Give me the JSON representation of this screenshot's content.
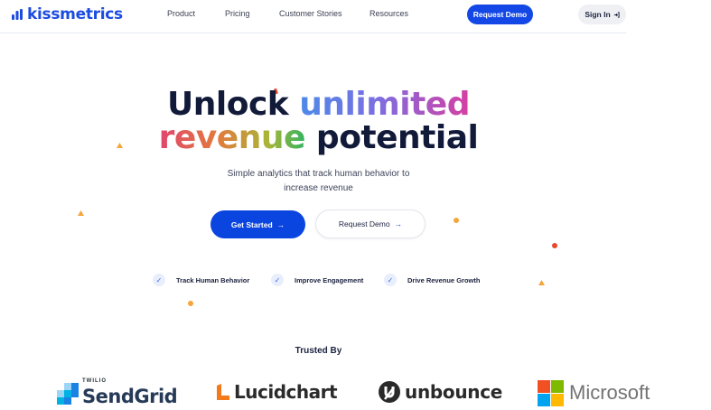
{
  "nav": {
    "logo_text": "kissmetrics",
    "links": [
      "Product",
      "Pricing",
      "Customer Stories",
      "Resources"
    ],
    "request_demo": "Request Demo",
    "sign_in": "Sign In"
  },
  "hero": {
    "title_line1_a": "Unlock",
    "title_line1_b": "unlimited",
    "title_line2_a": "revenue",
    "title_line2_b": "potential",
    "subtitle_line1": "Simple analytics that track human behavior to",
    "subtitle_line2": "increase revenue",
    "get_started": "Get Started",
    "request_demo": "Request Demo",
    "arrow": "→",
    "features": [
      "Track Human Behavior",
      "Improve Engagement",
      "Drive Revenue Growth"
    ],
    "check_glyph": "✓"
  },
  "trusted": {
    "heading": "Trusted By",
    "logos": {
      "sendgrid_top": "TWILIO",
      "sendgrid": "SendGrid",
      "lucidchart": "Lucidchart",
      "unbounce": "unbounce",
      "microsoft": "Microsoft"
    }
  },
  "colors": {
    "brand_blue": "#1348e6",
    "title_dark": "#121a3a",
    "deco_orange": "#f5a53a",
    "deco_red": "#e8482e"
  },
  "icons": {
    "logo": "bar-chart-icon",
    "sign_in": "sign-in-icon",
    "check": "check-icon"
  }
}
